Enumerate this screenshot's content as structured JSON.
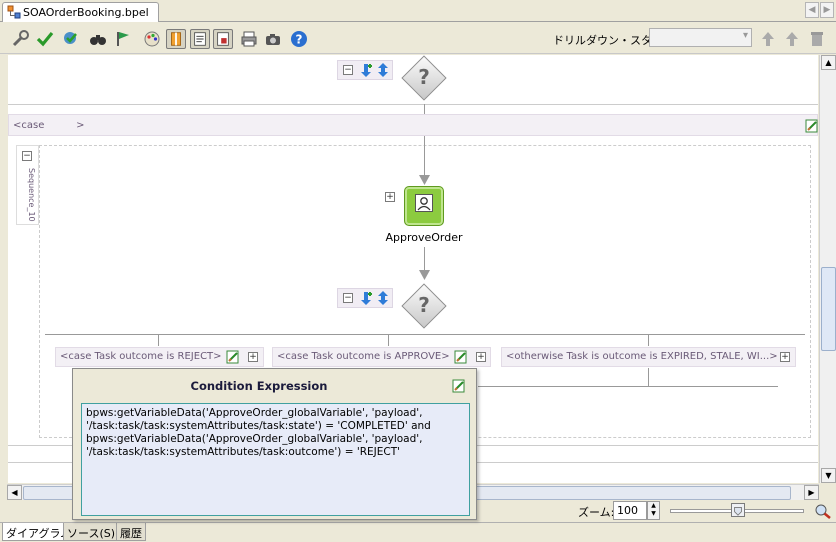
{
  "editor": {
    "file_tab": "SOAOrderBooking.bpel"
  },
  "toolbar": {
    "drill_label": "ドリルダウン・スタック:",
    "icons": [
      "wrench-icon",
      "check-icon",
      "validate-icon",
      "binoculars-icon",
      "flag-icon",
      "palette-icon",
      "layout-icon",
      "text-icon",
      "book-icon",
      "print-icon",
      "camera-icon",
      "help-icon"
    ]
  },
  "canvas": {
    "case_top_label": "<case          >",
    "sequence_label": "Sequence_10",
    "activity_label": "ApproveOrder",
    "cases": [
      {
        "label": "<case Task outcome is REJECT>"
      },
      {
        "label": "<case Task outcome is APPROVE>"
      },
      {
        "label": "<otherwise Task is outcome is EXPIRED, STALE, WI...>"
      }
    ],
    "question_mark": "?"
  },
  "popup": {
    "title": "Condition Expression",
    "expression": "bpws:getVariableData('ApproveOrder_globalVariable', 'payload',\n'/task:task/task:systemAttributes/task:state') = 'COMPLETED' and\nbpws:getVariableData('ApproveOrder_globalVariable', 'payload',\n'/task:task/task:systemAttributes/task:outcome') = 'REJECT'"
  },
  "status": {
    "zoom_label": "ズーム:",
    "zoom_value": "100"
  },
  "bottom_tabs": [
    {
      "label": "ダイアグラム",
      "active": true
    },
    {
      "label": "ソース(S)",
      "active": false
    },
    {
      "label": "履歴",
      "active": false
    }
  ],
  "colors": {
    "activity_green": "#8ccb3f",
    "popup_border": "#40a0a0",
    "popup_bg": "#e7ebf8"
  }
}
